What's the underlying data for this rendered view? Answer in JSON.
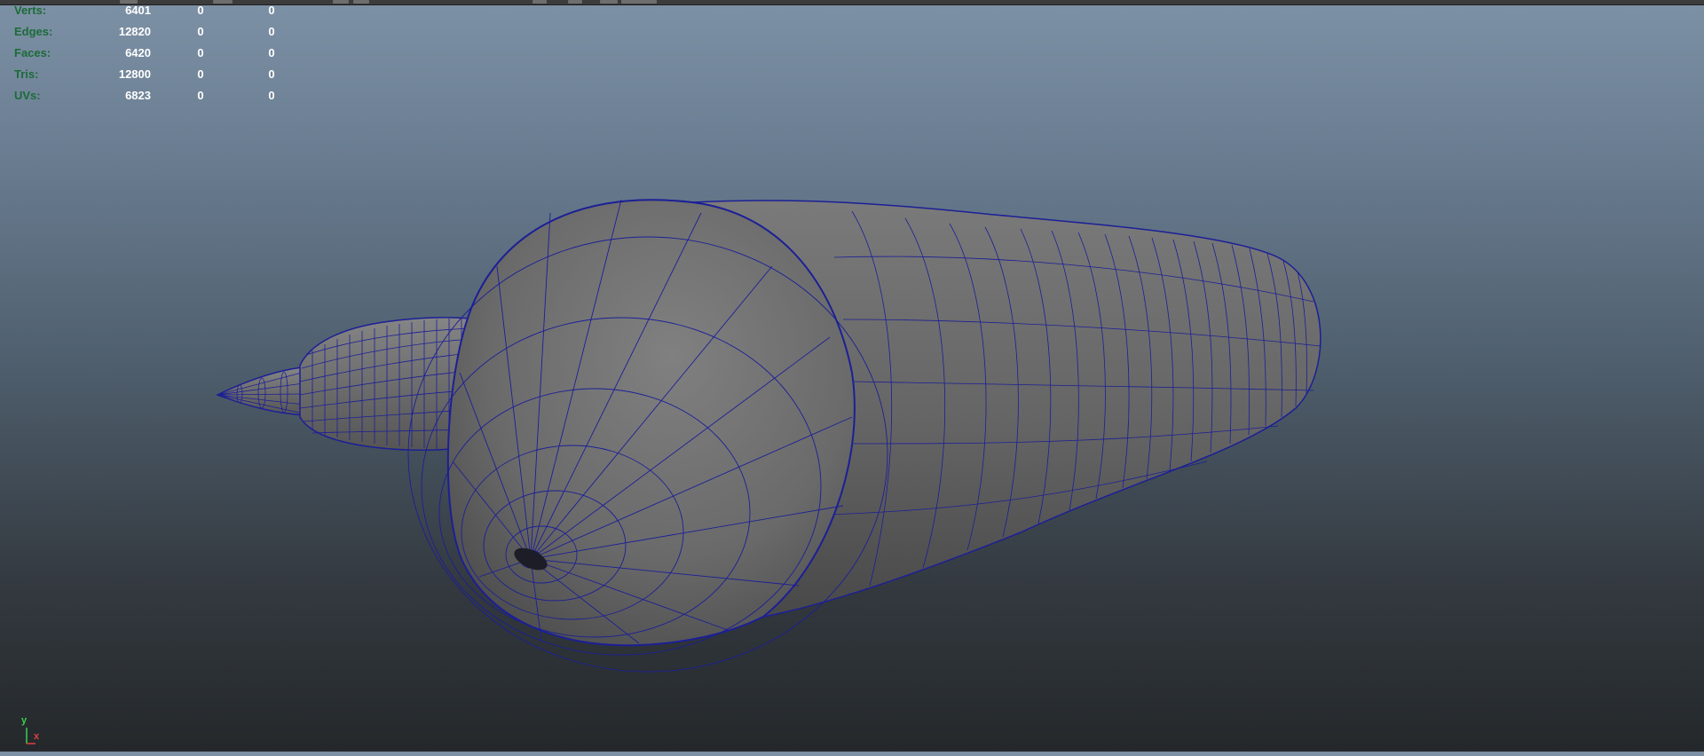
{
  "hud": {
    "rows": [
      {
        "label": "Verts:",
        "total": "6401",
        "selected": "0",
        "extra": "0"
      },
      {
        "label": "Edges:",
        "total": "12820",
        "selected": "0",
        "extra": "0"
      },
      {
        "label": "Faces:",
        "total": "6420",
        "selected": "0",
        "extra": "0"
      },
      {
        "label": "Tris:",
        "total": "12800",
        "selected": "0",
        "extra": "0"
      },
      {
        "label": "UVs:",
        "total": "6823",
        "selected": "0",
        "extra": "0"
      }
    ]
  },
  "axis_gizmo": {
    "y_label": "y",
    "x_label": "x"
  },
  "colors": {
    "wireframe": "#1c1f96",
    "mesh_surface": "#6b6b6b",
    "hud_label": "#1b6b38",
    "hud_value": "#ffffff",
    "axis_y": "#39d04f",
    "axis_x": "#e04040"
  }
}
